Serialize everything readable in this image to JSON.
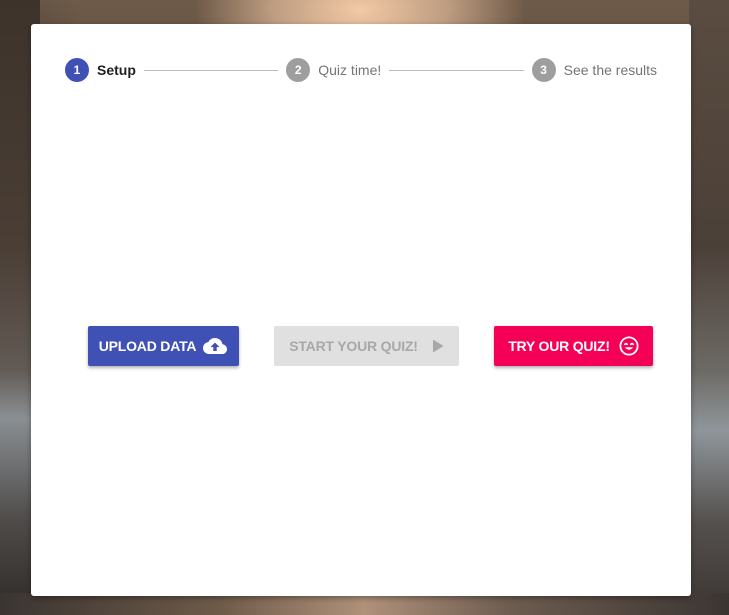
{
  "stepper": {
    "steps": [
      {
        "number": "1",
        "label": "Setup",
        "state": "active"
      },
      {
        "number": "2",
        "label": "Quiz time!",
        "state": "inactive"
      },
      {
        "number": "3",
        "label": "See the results",
        "state": "inactive"
      }
    ]
  },
  "actions": {
    "upload_label": "UPLOAD DATA",
    "upload_icon": "cloud-upload-icon",
    "start_label": "START YOUR QUIZ!",
    "start_icon": "play-arrow-icon",
    "try_label": "TRY OUR QUIZ!",
    "try_icon": "smiley-face-icon"
  },
  "colors": {
    "primary": "#3f51b5",
    "accent": "#f50057",
    "disabled_bg": "#e0e0e0",
    "disabled_text": "#a8a8a8",
    "inactive_step": "#9e9e9e"
  }
}
